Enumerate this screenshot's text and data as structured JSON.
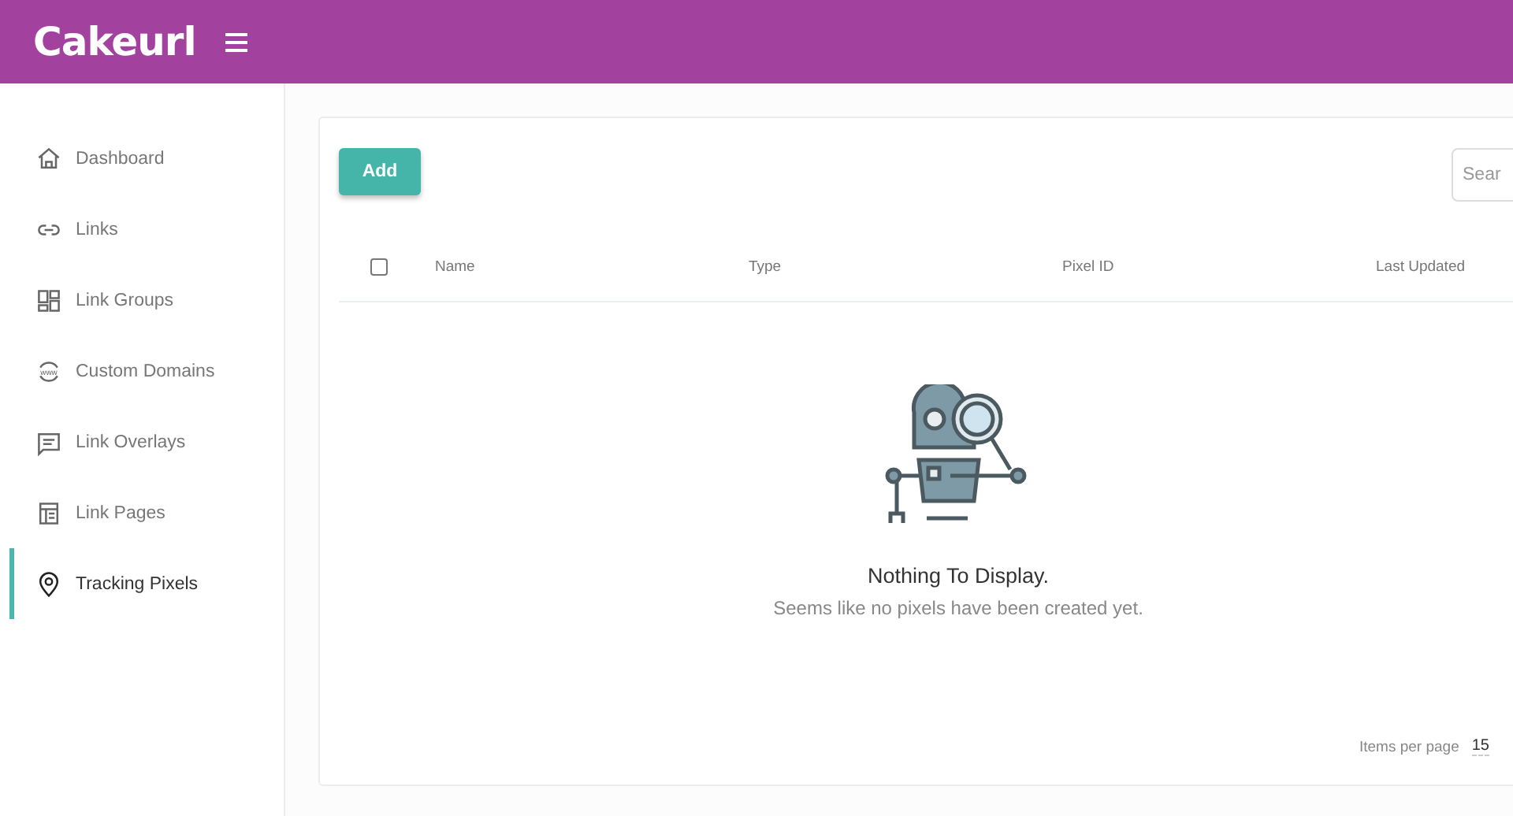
{
  "header": {
    "logo": "Cakeurl"
  },
  "sidebar": {
    "items": [
      {
        "label": "Dashboard",
        "kind": "home",
        "selected": false
      },
      {
        "label": "Links",
        "kind": "link",
        "selected": false
      },
      {
        "label": "Link Groups",
        "kind": "grid",
        "selected": false
      },
      {
        "label": "Custom Domains",
        "kind": "www",
        "selected": false
      },
      {
        "label": "Link Overlays",
        "kind": "message",
        "selected": false
      },
      {
        "label": "Link Pages",
        "kind": "page",
        "selected": false
      },
      {
        "label": "Tracking Pixels",
        "kind": "pin",
        "selected": true
      }
    ]
  },
  "toolbar": {
    "add_button": "Add",
    "search": {
      "placeholder": "Sear"
    }
  },
  "table": {
    "select_all": {
      "checked": false
    },
    "columns": [
      "Name",
      "Type",
      "Pixel ID",
      "Last Updated"
    ]
  },
  "empty_state": {
    "title": "Nothing To Display.",
    "message": "Seems like no pixels have been created yet."
  },
  "footer": {
    "items_per_page_label": "Items per page",
    "items_per_page": "15"
  }
}
